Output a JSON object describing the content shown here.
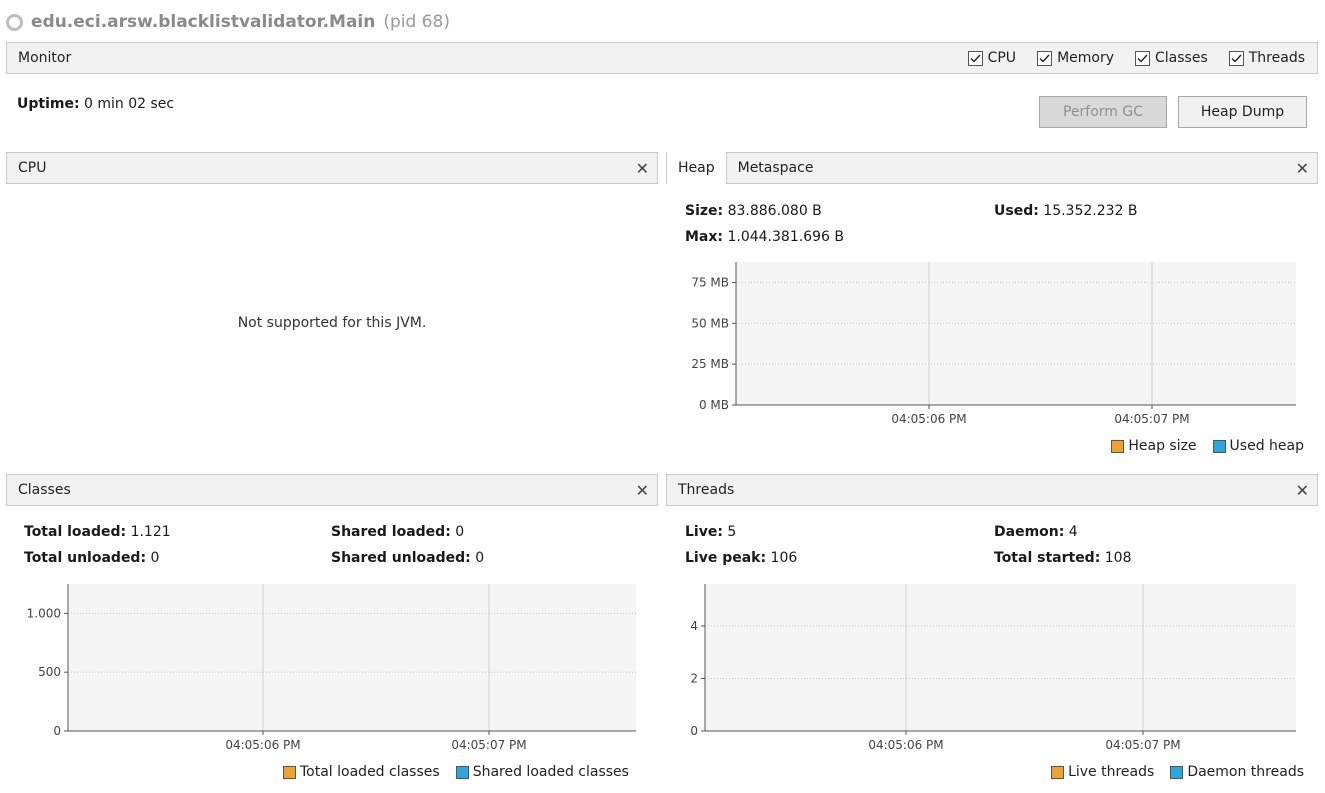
{
  "window": {
    "app_title": "edu.eci.arsw.blacklistvalidator.Main",
    "pid": "(pid 68)"
  },
  "monitor": {
    "label": "Monitor",
    "checkboxes": [
      {
        "label": "CPU",
        "checked": true
      },
      {
        "label": "Memory",
        "checked": true
      },
      {
        "label": "Classes",
        "checked": true
      },
      {
        "label": "Threads",
        "checked": true
      }
    ],
    "uptime_label": "Uptime:",
    "uptime_value": "0 min 02 sec",
    "perform_gc_label": "Perform GC",
    "heap_dump_label": "Heap Dump"
  },
  "cpu": {
    "label": "CPU",
    "message": "Not supported for this JVM."
  },
  "heap": {
    "tabs": [
      "Heap",
      "Metaspace"
    ],
    "size_label": "Size:",
    "size_value": "83.886.080 B",
    "used_label": "Used:",
    "used_value": "15.352.232 B",
    "max_label": "Max:",
    "max_value": "1.044.381.696 B"
  },
  "classes": {
    "label": "Classes",
    "total_loaded_label": "Total loaded:",
    "total_loaded_value": "1.121",
    "shared_loaded_label": "Shared loaded:",
    "shared_loaded_value": "0",
    "total_unloaded_label": "Total unloaded:",
    "total_unloaded_value": "0",
    "shared_unloaded_label": "Shared unloaded:",
    "shared_unloaded_value": "0"
  },
  "threads": {
    "label": "Threads",
    "live_label": "Live:",
    "live_value": "5",
    "daemon_label": "Daemon:",
    "daemon_value": "4",
    "live_peak_label": "Live peak:",
    "live_peak_value": "106",
    "total_started_label": "Total started:",
    "total_started_value": "108"
  },
  "colors": {
    "series_orange": "#f0a030",
    "series_blue": "#2aa6dc",
    "plot_bg": "#f5f5f5"
  },
  "chart_data": [
    {
      "type": "line",
      "id": "heap-chart",
      "x_ticks": [
        "04:05:06 PM",
        "04:05:07 PM"
      ],
      "y_ticks": [
        "0 MB",
        "25 MB",
        "50 MB",
        "75 MB"
      ],
      "ylim": [
        0,
        87.5
      ],
      "series": [
        {
          "name": "Heap size",
          "values": []
        },
        {
          "name": "Used heap",
          "values": []
        }
      ]
    },
    {
      "type": "line",
      "id": "classes-chart",
      "x_ticks": [
        "04:05:06 PM",
        "04:05:07 PM"
      ],
      "y_ticks": [
        "0",
        "500",
        "1.000"
      ],
      "ylim": [
        0,
        1250
      ],
      "series": [
        {
          "name": "Total loaded classes",
          "values": []
        },
        {
          "name": "Shared loaded classes",
          "values": []
        }
      ]
    },
    {
      "type": "line",
      "id": "threads-chart",
      "x_ticks": [
        "04:05:06 PM",
        "04:05:07 PM"
      ],
      "y_ticks": [
        "0",
        "2",
        "4"
      ],
      "ylim": [
        0,
        5.6
      ],
      "series": [
        {
          "name": "Live threads",
          "values": []
        },
        {
          "name": "Daemon threads",
          "values": []
        }
      ]
    }
  ]
}
